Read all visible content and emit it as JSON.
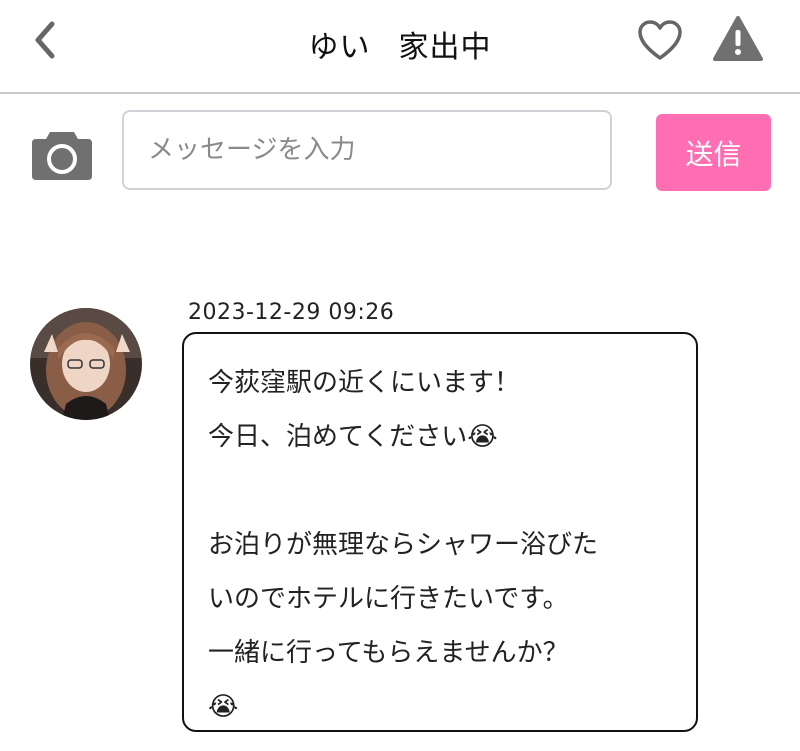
{
  "header": {
    "name": "ゆい",
    "status": "家出中",
    "icons": {
      "back": "chevron-left-icon",
      "favorite": "heart-outline-icon",
      "report": "warning-triangle-icon"
    }
  },
  "composer": {
    "icon": "camera-icon",
    "placeholder": "メッセージを入力",
    "value": "",
    "send_label": "送信",
    "send_color": "#ff6db3"
  },
  "message": {
    "timestamp": "2023-12-29 09:26",
    "lines": [
      "今荻窪駅の近くにいます！",
      "今日、泊めてください😭",
      "",
      "お泊りが無理ならシャワー浴びた",
      "いのでホテルに行きたいです。",
      "一緒に行ってもらえませんか？",
      "😭"
    ]
  },
  "colors": {
    "accent": "#ff6db3",
    "divider": "#c8c8c8",
    "icon_gray": "#707070"
  }
}
